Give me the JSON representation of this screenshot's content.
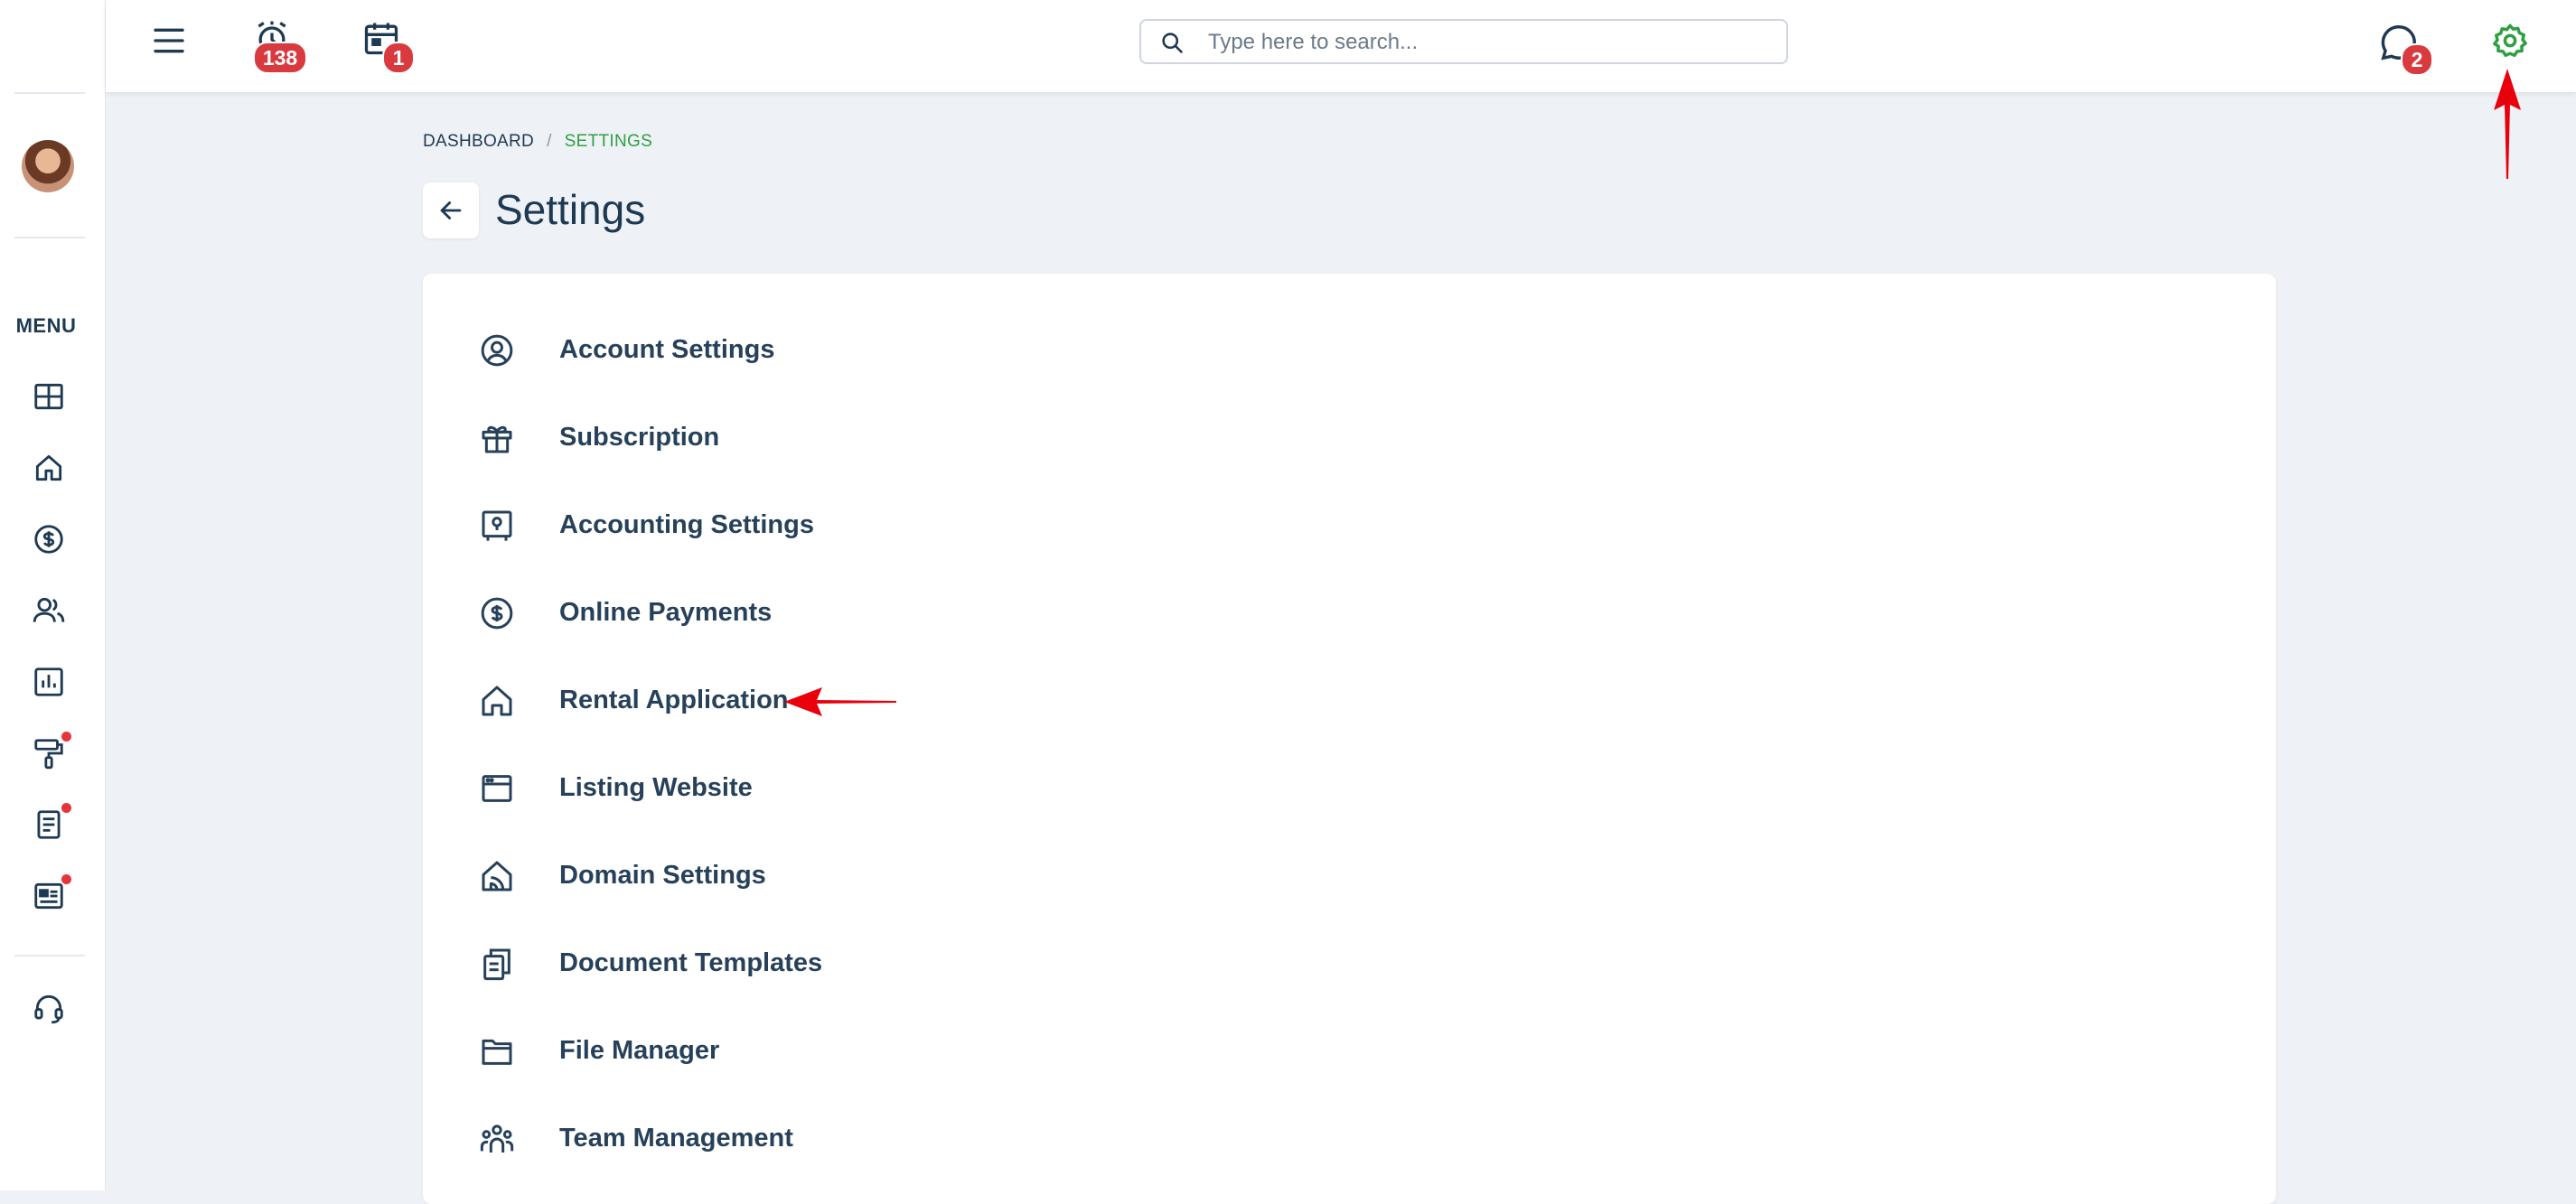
{
  "topbar": {
    "menu_icon": "hamburger-icon",
    "alarm_badge": "138",
    "calendar_badge": "1",
    "search_placeholder": "Type here to search...",
    "chat_badge": "2",
    "settings_icon_color": "#2ea043"
  },
  "sidebar": {
    "menu_label": "MENU",
    "items": [
      {
        "icon": "dashboard-icon",
        "dot": false
      },
      {
        "icon": "home-icon",
        "dot": false
      },
      {
        "icon": "dollar-icon",
        "dot": false
      },
      {
        "icon": "users-icon",
        "dot": false
      },
      {
        "icon": "reports-icon",
        "dot": false
      },
      {
        "icon": "paint-roller-icon",
        "dot": true
      },
      {
        "icon": "document-icon",
        "dot": true
      },
      {
        "icon": "news-icon",
        "dot": true
      },
      {
        "icon": "headset-icon",
        "dot": false
      }
    ]
  },
  "breadcrumb": {
    "items": [
      "DASHBOARD",
      "SETTINGS"
    ],
    "separator": "/"
  },
  "page": {
    "title": "Settings"
  },
  "settings": {
    "items": [
      {
        "label": "Account Settings",
        "icon": "user-circle-icon"
      },
      {
        "label": "Subscription",
        "icon": "gift-icon"
      },
      {
        "label": "Accounting Settings",
        "icon": "safe-icon"
      },
      {
        "label": "Online Payments",
        "icon": "dollar-circle-icon"
      },
      {
        "label": "Rental Application",
        "icon": "home-icon"
      },
      {
        "label": "Listing Website",
        "icon": "browser-window-icon"
      },
      {
        "label": "Domain Settings",
        "icon": "home-chart-icon"
      },
      {
        "label": "Document Templates",
        "icon": "copy-icon"
      },
      {
        "label": "File Manager",
        "icon": "folder-icon"
      },
      {
        "label": "Team Management",
        "icon": "team-icon"
      }
    ]
  },
  "colors": {
    "accent_green": "#2ea043",
    "badge_red": "#d93a3f",
    "annotation_red": "#e8000c",
    "text_dark": "#1e3a52",
    "background": "#eef1f6"
  }
}
